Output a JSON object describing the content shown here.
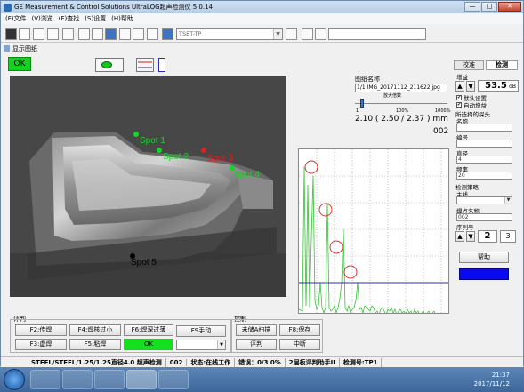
{
  "window": {
    "title": "GE Measurement & Control Solutions UltraLOG超声检测仪 5.0.14",
    "controls": [
      "—",
      "□",
      "✕"
    ]
  },
  "menu": [
    "(F)文件",
    "(V)浏览",
    "(F)查找",
    "(S)设置",
    "(H)帮助"
  ],
  "toolbar": {
    "probe_combo": "TSET-TP",
    "empty_combo": ""
  },
  "display": {
    "header": "显示图纸",
    "status": "OK"
  },
  "image": {
    "spots": [
      {
        "label": "Spot 1",
        "color": "#19d22a"
      },
      {
        "label": "Spot 2",
        "color": "#19d22a"
      },
      {
        "label": "Spot 3",
        "color": "#e02020"
      },
      {
        "label": "Spot 4",
        "color": "#19d22a"
      },
      {
        "label": "Spot 5",
        "color": "#000000"
      }
    ]
  },
  "image_info": {
    "title": "图纸名称",
    "file": "1/1 IMG_20171112_211622.jpg",
    "zoom_label": "放大倍数",
    "scale_ticks": [
      "1",
      "100%",
      "1000%"
    ],
    "measure": "2.10  ( 2.50 / 2.37 ) mm",
    "index": "002"
  },
  "right_panel": {
    "tabs": [
      "校准",
      "检测"
    ],
    "gain_label": "增益",
    "gain_value": "53.5",
    "gain_unit": "dB",
    "chk_default": "默认设置",
    "chk_auto": "自动增益",
    "probe_section": "所选择的探头",
    "name_label": "名称",
    "name_value": "",
    "code_label": "编号",
    "code_value": "",
    "diameter_label": "直径",
    "diameter_value": "4",
    "freq_label": "频率",
    "freq_value": "20",
    "detect_section": "检测策略",
    "master_label": "主线",
    "master_value": "",
    "point_name_label": "焊点名称",
    "point_name_value": "002",
    "serial_label": "序列号",
    "serial_value": "2",
    "serial_total": "3",
    "help_button": "帮助",
    "blue_button": ""
  },
  "bottom": {
    "eval_label": "评判",
    "control_label": "控制",
    "buttons": {
      "f2": "F2:传焊",
      "f4": "F4:焊核过小",
      "f6": "F6:焊深过薄",
      "f9": "F9手动",
      "f3": "F3:虚焊",
      "f5": "F5:粘焊",
      "ok": "OK",
      "select": "",
      "scanA": "未储A扫描",
      "f8": "F8:保存",
      "judge": "评判",
      "abort": "中断"
    }
  },
  "statusbar": [
    "STEEL/STEEL/1.25/1.25直径4.0  超声检测",
    "002",
    "状态:在线工作",
    "错误：0/3 0%",
    "2层板评判助手II",
    "检测号:TP1"
  ],
  "taskbar": {
    "time": "21:37",
    "date": "2017/11/12"
  },
  "colors": {
    "ok_green": "#14d11f",
    "signal_green": "#38c038",
    "gate_blue": "#2c2cb0",
    "circle_red": "#e03030"
  }
}
